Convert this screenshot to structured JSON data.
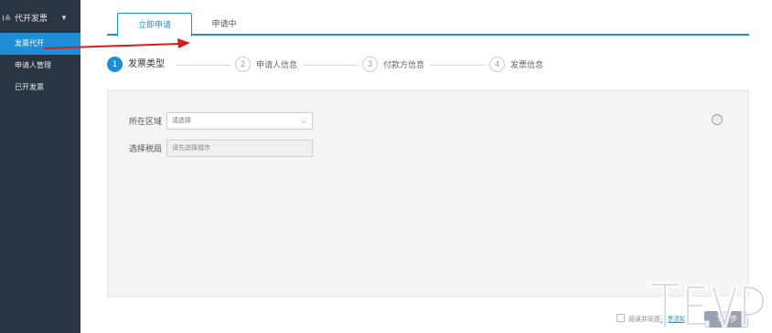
{
  "sidebar": {
    "group": {
      "icon": "invoice-icon",
      "label": "代开发票",
      "caret": "▼"
    },
    "items": [
      {
        "label": "发票代开",
        "active": true
      },
      {
        "label": "申请人管理",
        "active": false
      },
      {
        "label": "已开发票",
        "active": false
      }
    ]
  },
  "tabs": [
    {
      "label": "立即申请",
      "active": true
    },
    {
      "label": "申请中",
      "active": false
    }
  ],
  "steps": [
    {
      "num": "1",
      "label": "发票类型",
      "active": true
    },
    {
      "num": "2",
      "label": "申请人信息",
      "active": false
    },
    {
      "num": "3",
      "label": "付款方信息",
      "active": false
    },
    {
      "num": "4",
      "label": "发票信息",
      "active": false
    }
  ],
  "form": {
    "region": {
      "label": "所在区域",
      "value": "请选择"
    },
    "tax_office": {
      "label": "选择税局",
      "placeholder": "请先选择城市"
    },
    "info_icon": "ⓘ"
  },
  "footer": {
    "agree_prefix": "阅读并同意",
    "agree_link": "开票须知",
    "next_label": "下一步"
  },
  "accent_color": "#1f8ed6",
  "sidebar_color": "#2b3441",
  "annotation_arrow_color": "#d02020"
}
